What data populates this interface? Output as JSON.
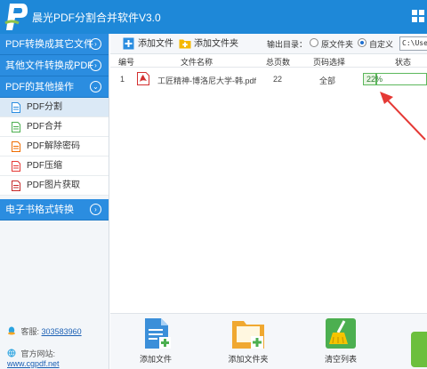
{
  "app": {
    "title": "晨光PDF分割合并软件V3.0"
  },
  "sidebar": {
    "sections": [
      {
        "label": "PDF转换成其它文件",
        "arrow": "›"
      },
      {
        "label": "其他文件转换成PDF",
        "arrow": "›"
      },
      {
        "label": "PDF的其他操作",
        "arrow": "⌄"
      }
    ],
    "items": [
      {
        "label": "PDF分割",
        "active": true
      },
      {
        "label": "PDF合并"
      },
      {
        "label": "PDF解除密码"
      },
      {
        "label": "PDF压缩"
      },
      {
        "label": "PDF图片获取"
      }
    ],
    "ebook": {
      "label": "电子书格式转换",
      "arrow": "›"
    },
    "contact": {
      "qq_label": "客服:",
      "qq_value": "303583960",
      "site_label": "官方网站:",
      "site_value": "www.cgpdf.net"
    }
  },
  "toolbar": {
    "add_file": "添加文件",
    "add_folder": "添加文件夹",
    "output_label": "输出目录：",
    "radio_source": "原文件夹",
    "radio_custom": "自定义",
    "path_value": "C:\\User"
  },
  "table": {
    "headers": [
      "编号",
      "文件名称",
      "总页数",
      "页码选择",
      "状态"
    ],
    "rows": [
      {
        "index": "1",
        "filename": "工匠精神-博洛尼大学-韩.pdf",
        "pages": "22",
        "range": "全部",
        "status": "22%",
        "progress": 0.22
      }
    ]
  },
  "bottom": {
    "add_file": "添加文件",
    "add_folder": "添加文件夹",
    "clear_list": "清空列表"
  },
  "colors": {
    "accent": "#1e88d8",
    "nav_head": "#2b8de0",
    "progress": "#5cb85c",
    "arrow": "#e53935"
  }
}
